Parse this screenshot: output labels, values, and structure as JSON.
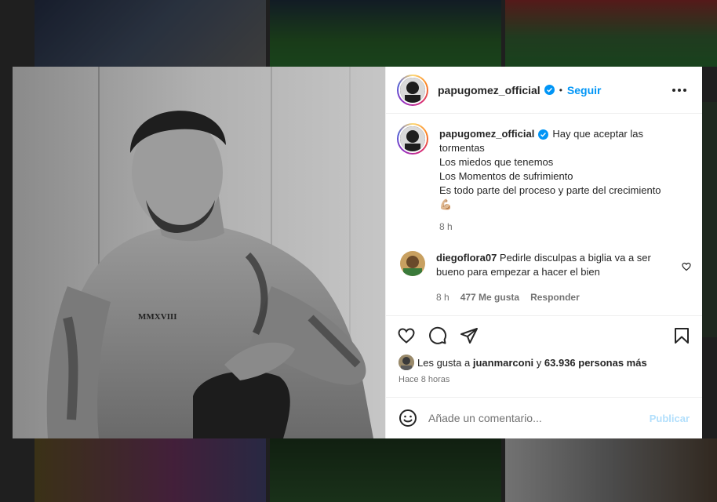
{
  "post": {
    "username": "papugomez_official",
    "follow_label": "Seguir",
    "separator": "•",
    "caption_lines": [
      "Hay que aceptar las tormentas",
      "Los miedos que tenemos",
      "Los Momentos de sufrimiento",
      "Es todo parte del proceso y parte del crecimiento",
      "💪🏼"
    ],
    "caption_time": "8 h",
    "photo_tattoo_text": "MMXVIII"
  },
  "comment": {
    "username": "diegoflora07",
    "text": "Pedirle disculpas a biglia va a ser bueno para empezar a hacer el bien",
    "time": "8 h",
    "likes": "477 Me gusta",
    "reply_label": "Responder"
  },
  "likes": {
    "prefix": "Les gusta a",
    "user": "juanmarconi",
    "connector": "y",
    "others": "63.936 personas más"
  },
  "timestamp": "Hace 8 horas",
  "composer": {
    "placeholder": "Añade un comentario...",
    "publish_label": "Publicar"
  },
  "colors": {
    "link_blue": "#0095f6",
    "publish_disabled": "#b2dffc",
    "text_primary": "#262626",
    "text_secondary": "#737373",
    "verified": "#0095f6"
  }
}
